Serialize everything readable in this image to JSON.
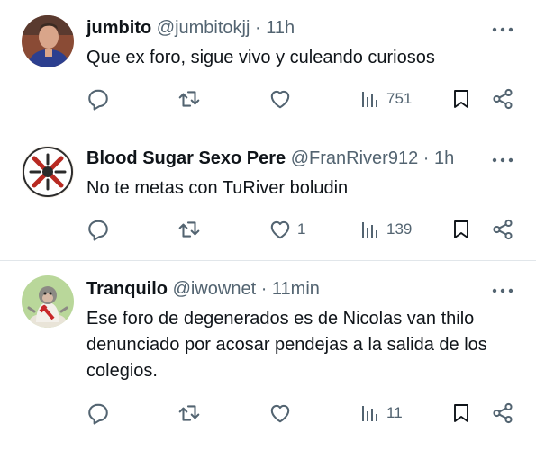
{
  "tweets": [
    {
      "display_name": "jumbito",
      "handle": "@jumbitokjj",
      "separator": "·",
      "time": "11h",
      "text": "Que ex foro, sigue vivo y culeando curiosos",
      "likes": "",
      "views": "751"
    },
    {
      "display_name": "Blood Sugar Sexo Pere",
      "handle": "@FranRiver912",
      "separator": "·",
      "time": "1h",
      "text": "No te metas con TuRiver boludin",
      "likes": "1",
      "views": "139"
    },
    {
      "display_name": "Tranquilo",
      "handle": "@iwownet",
      "separator": "·",
      "time": "11min",
      "text": "Ese foro de degenerados es de Nicolas van thilo denunciado por acosar pendejas a la salida de los colegios.",
      "likes": "",
      "views": "11"
    }
  ],
  "colors": {
    "text_primary": "#0f1419",
    "text_secondary": "#536471",
    "divider": "#e1e6ea",
    "background": "#ffffff"
  },
  "icons": [
    "reply-icon",
    "retweet-icon",
    "like-icon",
    "views-icon",
    "bookmark-icon",
    "share-icon",
    "more-icon"
  ]
}
